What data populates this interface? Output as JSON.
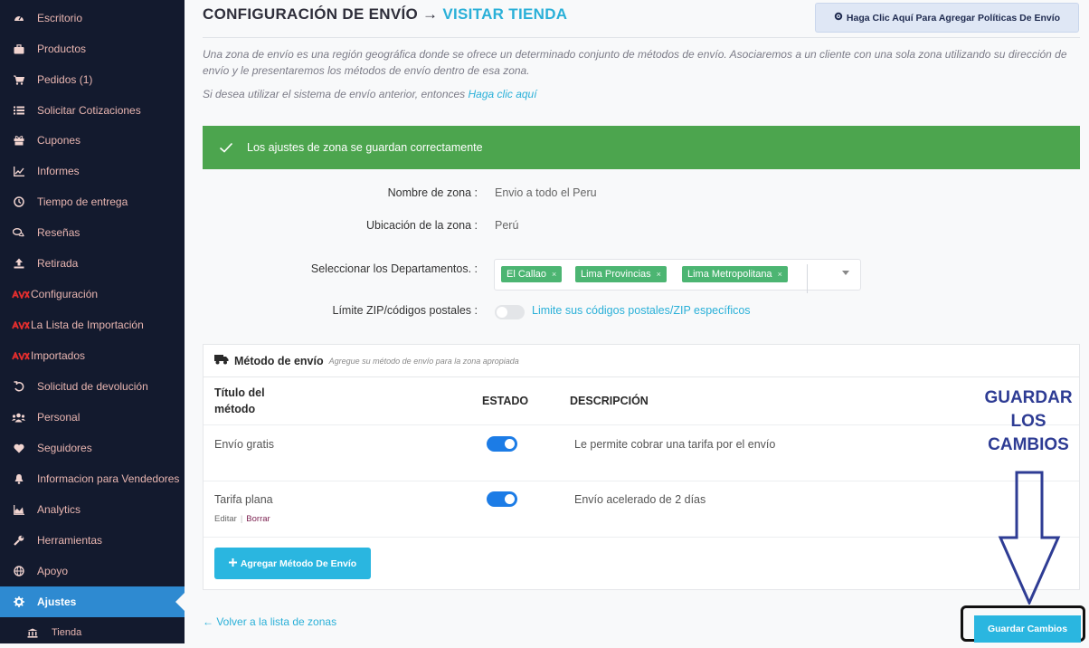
{
  "sidebar": {
    "items": [
      {
        "label": "Escritorio",
        "icon": "dashboard-icon"
      },
      {
        "label": "Productos",
        "icon": "briefcase-icon"
      },
      {
        "label": "Pedidos (1)",
        "icon": "cart-icon"
      },
      {
        "label": "Solicitar Cotizaciones",
        "icon": "list-icon"
      },
      {
        "label": "Cupones",
        "icon": "gift-icon"
      },
      {
        "label": "Informes",
        "icon": "chart-icon"
      },
      {
        "label": "Tiempo de entrega",
        "icon": "clock-icon"
      },
      {
        "label": "Reseñas",
        "icon": "comments-icon"
      },
      {
        "label": "Retirada",
        "icon": "upload-icon"
      },
      {
        "label": "Configuración",
        "icon": "aliexpress-icon"
      },
      {
        "label": "La Lista de Importación",
        "icon": "aliexpress-icon"
      },
      {
        "label": "Importados",
        "icon": "aliexpress-icon"
      },
      {
        "label": "Solicitud de devolución",
        "icon": "undo-icon"
      },
      {
        "label": "Personal",
        "icon": "users-icon"
      },
      {
        "label": "Seguidores",
        "icon": "heart-icon"
      },
      {
        "label": "Informacion para Vendedores",
        "icon": "bell-icon"
      },
      {
        "label": "Analytics",
        "icon": "area-chart-icon"
      },
      {
        "label": "Herramientas",
        "icon": "wrench-icon"
      },
      {
        "label": "Apoyo",
        "icon": "globe-icon"
      },
      {
        "label": "Ajustes",
        "icon": "gear-icon"
      }
    ],
    "sub_item": {
      "label": "Tienda",
      "icon": "bank-icon"
    }
  },
  "header": {
    "title": "CONFIGURACIÓN DE ENVÍO →",
    "visit": "VISITAR TIENDA",
    "policy_button": "Haga Clic Aquí Para Agregar Políticas De Envío"
  },
  "intro": {
    "text": "Una zona de envío es una región geográfica donde se ofrece un determinado conjunto de métodos de envío. Asociaremos a un cliente con una sola zona utilizando su dirección de envío y le presentaremos los métodos de envío dentro de esa zona.",
    "legacy_prefix": "Si desea utilizar el sistema de envío anterior, entonces",
    "legacy_link": "Haga clic aquí"
  },
  "alert": {
    "text": "Los ajustes de zona se guardan correctamente"
  },
  "form": {
    "zone_name_label": "Nombre de zona :",
    "zone_name_value": "Envio a todo el Peru",
    "zone_location_label": "Ubicación de la zona :",
    "zone_location_value": "Perú",
    "departments_label": "Seleccionar los Departamentos. :",
    "departments": [
      "El Callao",
      "Lima Provincias",
      "Lima Metropolitana"
    ],
    "zip_label": "Límite ZIP/códigos postales :",
    "zip_link": "Limite sus códigos postales/ZIP específicos"
  },
  "methods": {
    "title": "Método de envío",
    "subtitle": "Agregue su método de envío para la zona apropiada",
    "col_title": "Título del método",
    "col_status": "ESTADO",
    "col_desc": "DESCRIPCIÓN",
    "rows": [
      {
        "name": "Envío gratis",
        "desc": "Le permite cobrar una tarifa por el envío"
      },
      {
        "name": "Tarifa plana",
        "desc": "Envío acelerado de 2 días"
      }
    ],
    "edit": "Editar",
    "delete": "Borrar",
    "add_button": "Agregar Método De Envío"
  },
  "footer": {
    "back": "← Volver a la lista de zonas",
    "save": "Guardar Cambios"
  },
  "annotation": {
    "line1": "GUARDAR",
    "line2": "LOS",
    "line3": "CAMBIOS"
  }
}
